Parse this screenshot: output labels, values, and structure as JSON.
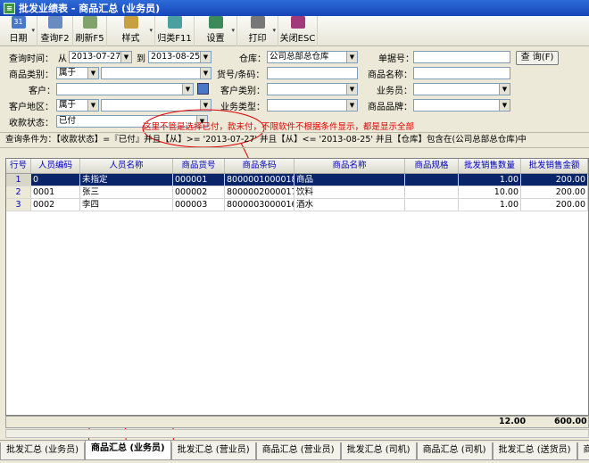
{
  "window": {
    "title": "批发业绩表 - 商品汇总 (业务员)",
    "app_icon": "app-icon"
  },
  "toolbar": {
    "date": "日期",
    "query": "查询F2",
    "refresh": "刷新F5",
    "style": "样式",
    "classify": "归类F11",
    "settings": "设置",
    "print": "打印",
    "close": "关闭ESC"
  },
  "filter": {
    "query_time_label": "查询时间：",
    "from_label": "从",
    "from_value": "2013-07-27",
    "to_label": "到",
    "to_value": "2013-08-25",
    "warehouse_label": "仓库：",
    "warehouse_value": "公司总部总仓库",
    "doc_no_label": "单据号：",
    "query_button": "查 询(F)",
    "product_category_label": "商品类别：",
    "product_category_value": "属于",
    "barcode_label": "货号/条码：",
    "product_name_label": "商品名称：",
    "customer_label": "客户：",
    "customer_type_label": "客户类别：",
    "salesman_label": "业务员：",
    "customer_region_label": "客户地区：",
    "customer_region_value": "属于",
    "business_type_label": "业务类型：",
    "product_brand_label": "商品品牌：",
    "payment_status_label": "收款状态：",
    "payment_status_value": "已付"
  },
  "annotation": "这里不管是选择已付，款未付，不限软件不根据条件显示，都是显示全部",
  "condition_text": "查询条件为：【收款状态】=『已付』并且【从】>= '2013-07-27' 并且【从】<= '2013-08-25' 并且【仓库】包含在(公司总部总仓库)中",
  "table": {
    "headers": [
      "行号",
      "人员编码",
      "人员名称",
      "商品货号",
      "商品条码",
      "商品名称",
      "商品规格",
      "批发销售数量",
      "批发销售金额"
    ],
    "rows": [
      [
        "1",
        "0",
        "未指定",
        "000001",
        "8000001000018",
        "商品",
        "",
        "1.00",
        "200.00"
      ],
      [
        "2",
        "0001",
        "张三",
        "000002",
        "8000002000017",
        "饮料",
        "",
        "10.00",
        "200.00"
      ],
      [
        "3",
        "0002",
        "李四",
        "000003",
        "8000003000016",
        "酒水",
        "",
        "1.00",
        "200.00"
      ]
    ],
    "total_qty": "12.00",
    "total_amount": "600.00"
  },
  "tabs": [
    "批发汇总 (业务员)",
    "商品汇总 (业务员)",
    "批发汇总 (营业员)",
    "商品汇总 (营业员)",
    "批发汇总 (司机)",
    "商品汇总 (司机)",
    "批发汇总 (送货员)",
    "商品"
  ]
}
